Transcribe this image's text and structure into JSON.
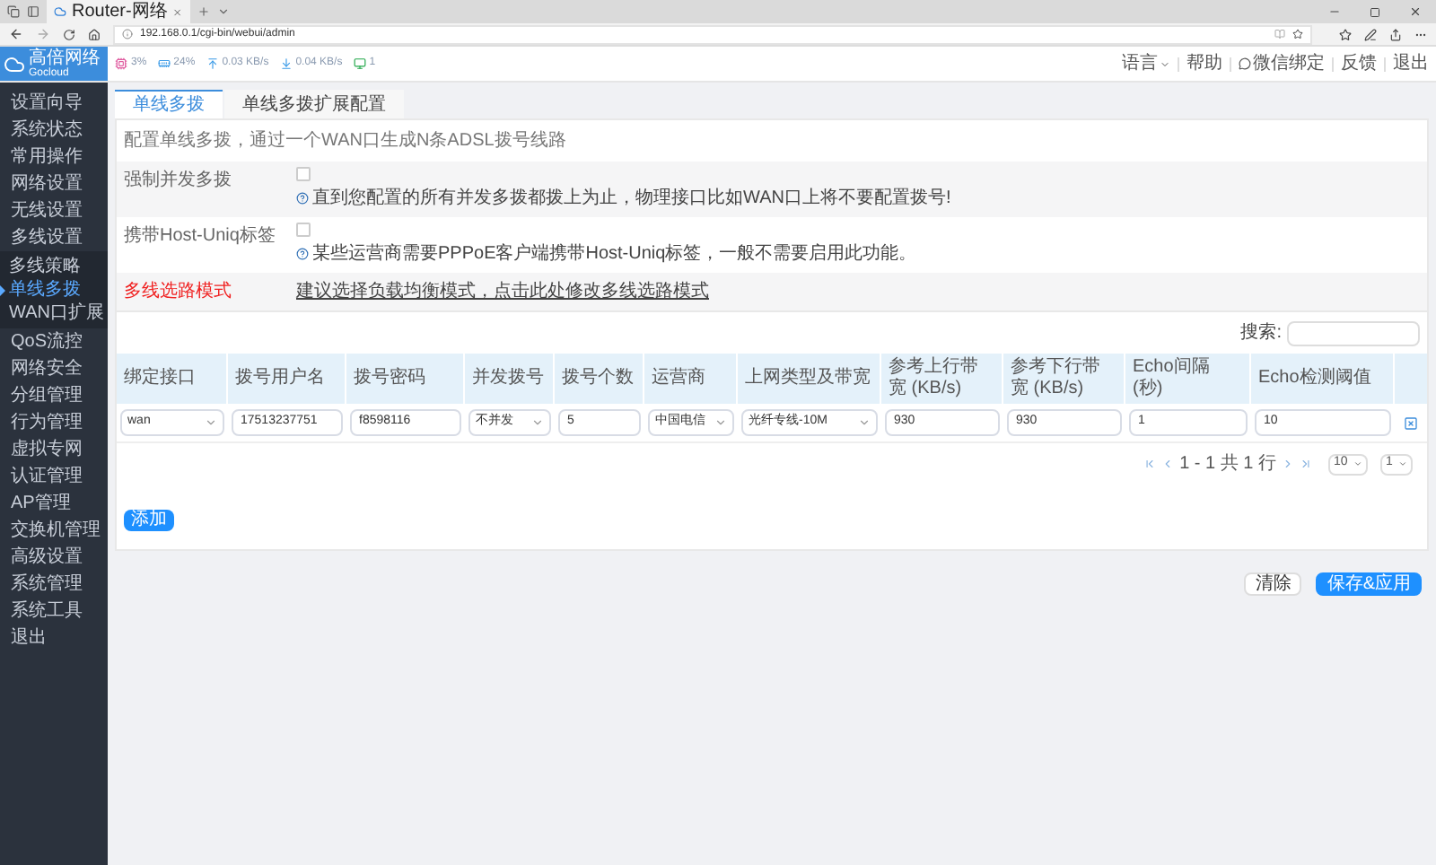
{
  "browser": {
    "tab_title": "Router-网络",
    "address": "192.168.0.1/cgi-bin/webui/admin"
  },
  "header": {
    "logo_title": "高倍网络",
    "logo_subtitle": "Gocloud",
    "stats": [
      {
        "kind": "cpu",
        "text": "3%"
      },
      {
        "kind": "memory",
        "text": "24%"
      },
      {
        "kind": "upload",
        "text": "0.03 KB/s"
      },
      {
        "kind": "download",
        "text": "0.04 KB/s"
      },
      {
        "kind": "devices",
        "text": "1"
      }
    ],
    "links": [
      {
        "kind": "dropdown",
        "label": "语言"
      },
      {
        "kind": "plain",
        "label": "帮助"
      },
      {
        "kind": "wechat",
        "label": "微信绑定"
      },
      {
        "kind": "plain",
        "label": "反馈"
      },
      {
        "kind": "plain",
        "label": "退出"
      }
    ]
  },
  "sidebar": {
    "items": [
      {
        "label": "设置向导"
      },
      {
        "label": "系统状态"
      },
      {
        "label": "常用操作"
      },
      {
        "label": "网络设置"
      },
      {
        "label": "无线设置"
      },
      {
        "label": "多线设置",
        "expanded": true,
        "children": [
          {
            "label": "多线策略",
            "selected": false
          },
          {
            "label": "单线多拨",
            "selected": true
          },
          {
            "label": "WAN口扩展",
            "selected": false
          }
        ]
      },
      {
        "label": "QoS流控"
      },
      {
        "label": "网络安全"
      },
      {
        "label": "分组管理"
      },
      {
        "label": "行为管理"
      },
      {
        "label": "虚拟专网"
      },
      {
        "label": "认证管理"
      },
      {
        "label": "AP管理"
      },
      {
        "label": "交换机管理"
      },
      {
        "label": "高级设置"
      },
      {
        "label": "系统管理"
      },
      {
        "label": "系统工具"
      },
      {
        "label": "退出"
      }
    ]
  },
  "tabs": [
    {
      "label": "单线多拨",
      "selected": true
    },
    {
      "label": "单线多拨扩展配置",
      "selected": false
    }
  ],
  "description": "配置单线多拨，通过一个WAN口生成N条ADSL拨号线路",
  "options": [
    {
      "label": "强制并发多拨",
      "checked": false,
      "hint": "直到您配置的所有并发多拨都拨上为止，物理接口比如WAN口上将不要配置拨号!"
    },
    {
      "label": "携带Host-Uniq标签",
      "checked": false,
      "hint": "某些运营商需要PPPoE客户端携带Host-Uniq标签，一般不需要启用此功能。"
    }
  ],
  "route_mode": {
    "label": "多线选路模式",
    "link": "建议选择负载均衡模式，点击此处修改多线选路模式"
  },
  "table": {
    "search_label": "搜索:",
    "columns": [
      "绑定接口",
      "拨号用户名",
      "拨号密码",
      "并发拨号",
      "拨号个数",
      "运营商",
      "上网类型及带宽",
      "参考上行带宽 (KB/s)",
      "参考下行带宽 (KB/s)",
      "Echo间隔 (秒)",
      "Echo检测阈值"
    ],
    "rows": [
      [
        {
          "kind": "select",
          "value": "wan"
        },
        {
          "kind": "input",
          "value": "17513237751"
        },
        {
          "kind": "input",
          "value": "f8598116"
        },
        {
          "kind": "select",
          "value": "不并发"
        },
        {
          "kind": "input",
          "value": "5"
        },
        {
          "kind": "select",
          "value": "中国电信"
        },
        {
          "kind": "select",
          "value": "光纤专线-10M"
        },
        {
          "kind": "input",
          "value": "930"
        },
        {
          "kind": "input",
          "value": "930"
        },
        {
          "kind": "input",
          "value": "1"
        },
        {
          "kind": "input",
          "value": "10"
        }
      ]
    ],
    "pagination": {
      "info": "1 - 1 共 1 行",
      "page_size": "10",
      "page": "1"
    }
  },
  "add_button": "添加",
  "buttons": [
    {
      "kind": "secondary",
      "label": "清除"
    },
    {
      "kind": "primary",
      "label": "保存&应用"
    }
  ]
}
